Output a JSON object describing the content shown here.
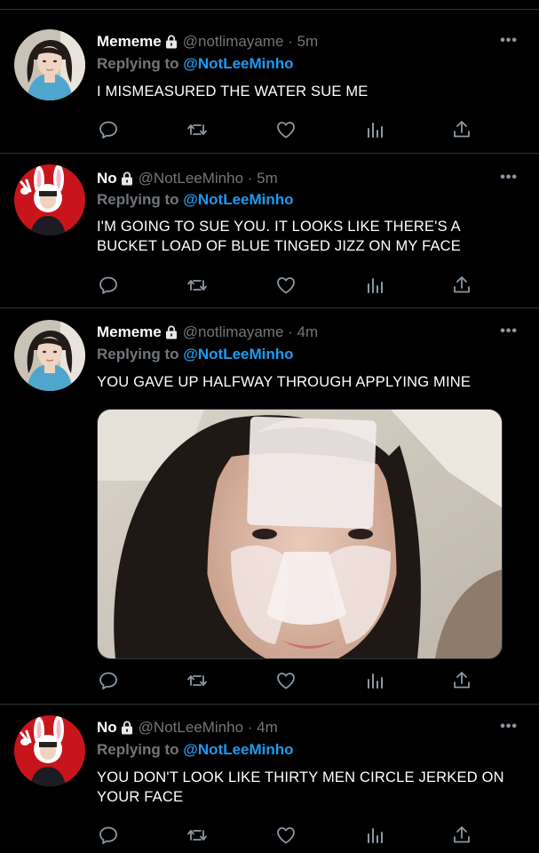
{
  "tweets": [
    {
      "name": "Mememe",
      "handle": "@notlimayame",
      "time": "· 5m",
      "replying_label": "Replying to",
      "replying_to": "@NotLeeMinho",
      "text": "I MISMEASURED THE WATER SUE ME",
      "avatar": "woman-portrait",
      "locked": true
    },
    {
      "name": "No",
      "handle": "@NotLeeMinho",
      "time": "· 5m",
      "replying_label": "Replying to",
      "replying_to": "@NotLeeMinho",
      "text": "I'M GOING TO SUE YOU. IT LOOKS LIKE THERE'S A BUCKET LOAD OF BLUE TINGED JIZZ ON MY FACE",
      "avatar": "bunny-costume-red",
      "locked": true
    },
    {
      "name": "Mememe",
      "handle": "@notlimayame",
      "time": "· 4m",
      "replying_label": "Replying to",
      "replying_to": "@NotLeeMinho",
      "text": "YOU GAVE UP HALFWAY THROUGH APPLYING MINE",
      "avatar": "woman-portrait",
      "locked": true,
      "media": "selfie-with-face-sheet-mask"
    },
    {
      "name": "No",
      "handle": "@NotLeeMinho",
      "time": "· 4m",
      "replying_label": "Replying to",
      "replying_to": "@NotLeeMinho",
      "text": "YOU DON'T LOOK LIKE THIRTY MEN CIRCLE JERKED ON YOUR FACE",
      "avatar": "bunny-costume-red",
      "locked": true
    }
  ],
  "more_glyph": "•••",
  "icons": [
    "reply-icon",
    "retweet-icon",
    "like-icon",
    "analytics-icon",
    "share-icon",
    "lock-icon",
    "more-icon"
  ],
  "colors": {
    "background": "#000000",
    "mention": "#1d9bf0",
    "muted": "#71767b",
    "separator": "#2f3336"
  }
}
